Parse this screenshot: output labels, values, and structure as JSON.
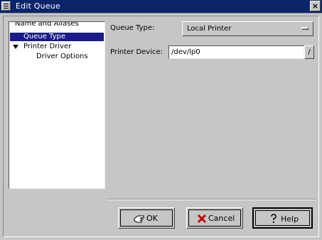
{
  "window": {
    "title": "Edit Queue",
    "close_glyph": "×"
  },
  "tree": {
    "items": [
      {
        "label": "Name and Aliases"
      },
      {
        "label": "Queue Type"
      },
      {
        "label": "Printer Driver"
      },
      {
        "label": "Driver Options"
      }
    ]
  },
  "form": {
    "queue_type_label": "Queue Type:",
    "queue_type_value": "Local Printer",
    "printer_device_label": "Printer Device:",
    "printer_device_value": "/dev/lp0",
    "device_button_glyph": "/"
  },
  "buttons": {
    "ok": {
      "label": "OK",
      "icon": "hand-icon"
    },
    "cancel": {
      "label": "Cancel",
      "icon": "x-icon"
    },
    "help": {
      "label": "Help",
      "icon": "question-icon"
    }
  },
  "colors": {
    "titlebar": "#0a246a",
    "selection": "#1a1a8a",
    "background": "#c6c6c6"
  }
}
